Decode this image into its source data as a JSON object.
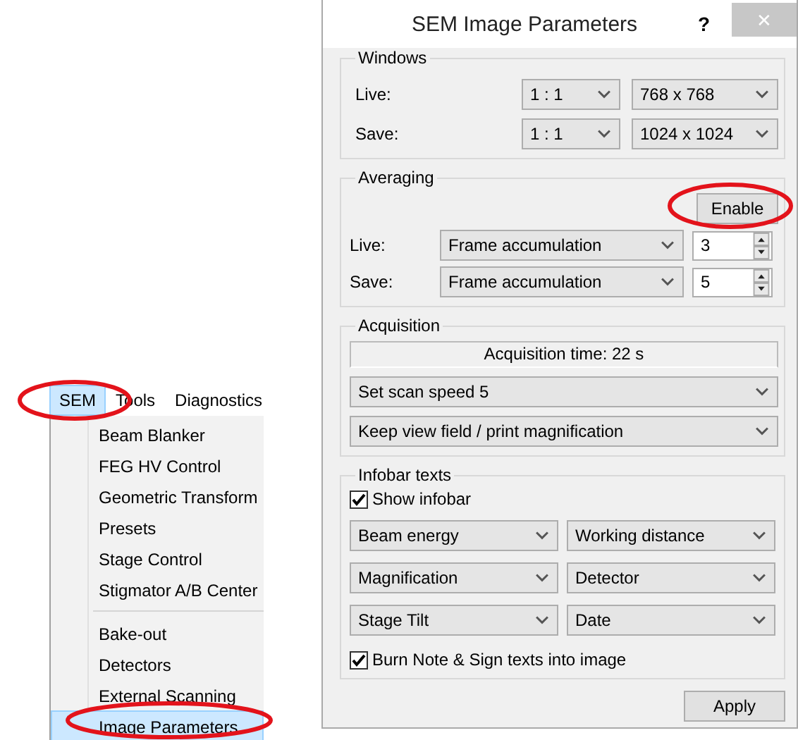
{
  "menu_bar": [
    {
      "label": "SEM",
      "selected": true
    },
    {
      "label": "Tools",
      "selected": false
    },
    {
      "label": "Diagnostics",
      "selected": false
    }
  ],
  "menu_sections": [
    [
      {
        "label": "Beam Blanker",
        "selected": false
      },
      {
        "label": "FEG HV Control",
        "selected": false
      },
      {
        "label": "Geometric Transform",
        "selected": false
      },
      {
        "label": "Presets",
        "selected": false
      },
      {
        "label": "Stage Control",
        "selected": false
      },
      {
        "label": "Stigmator A/B Center",
        "selected": false
      }
    ],
    [
      {
        "label": "Bake-out",
        "selected": false
      },
      {
        "label": "Detectors",
        "selected": false
      },
      {
        "label": "External Scanning",
        "selected": false
      },
      {
        "label": "Image Parameters",
        "selected": true
      }
    ]
  ],
  "dialog": {
    "title": "SEM Image Parameters",
    "help": "?",
    "close": "✕",
    "windows": {
      "title": "Windows",
      "rows": [
        {
          "label": "Live:",
          "ratio": "1 : 1",
          "size": "768 x 768"
        },
        {
          "label": "Save:",
          "ratio": "1 : 1",
          "size": "1024 x 1024"
        }
      ]
    },
    "averaging": {
      "title": "Averaging",
      "button": "Enable",
      "rows": [
        {
          "label": "Live:",
          "mode": "Frame accumulation",
          "count": "3"
        },
        {
          "label": "Save:",
          "mode": "Frame accumulation",
          "count": "5"
        }
      ]
    },
    "acquisition": {
      "title": "Acquisition",
      "time": "Acquisition time: 22 s",
      "selects": [
        "Set scan speed 5",
        "Keep view field / print magnification"
      ]
    },
    "infobar": {
      "title": "Infobar texts",
      "show": {
        "label": "Show infobar",
        "checked": true
      },
      "selects": [
        [
          "Beam energy",
          "Working distance"
        ],
        [
          "Magnification",
          "Detector"
        ],
        [
          "Stage Tilt",
          "Date"
        ]
      ],
      "burn": {
        "label": "Burn Note & Sign texts into image",
        "checked": true
      }
    },
    "apply": "Apply"
  }
}
